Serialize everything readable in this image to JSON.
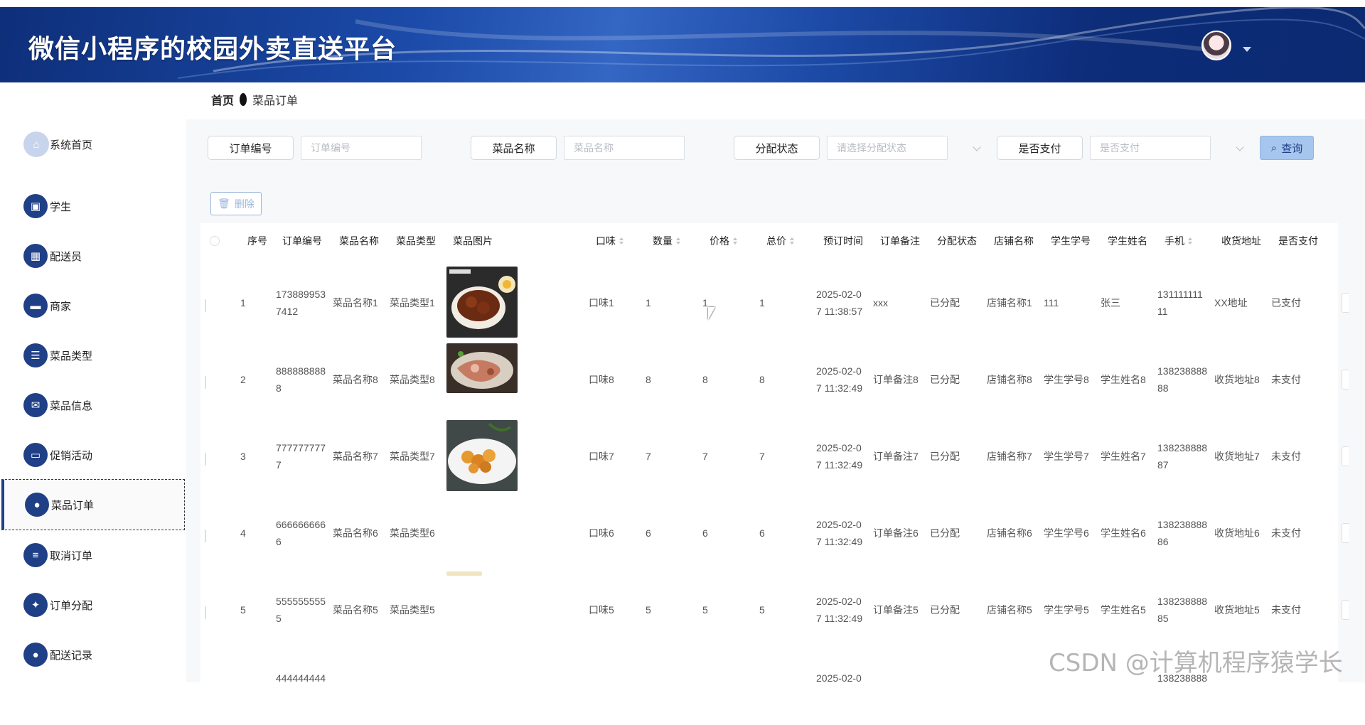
{
  "header": {
    "title": "微信小程序的校园外卖直送平台"
  },
  "breadcrumb": {
    "home": "首页",
    "current": "菜品订单"
  },
  "sidebar": {
    "items": [
      {
        "label": "系统首页",
        "icon": "home-icon"
      },
      {
        "label": "学生",
        "icon": "clipboard-icon"
      },
      {
        "label": "配送员",
        "icon": "grid-icon"
      },
      {
        "label": "商家",
        "icon": "monitor-icon"
      },
      {
        "label": "菜品类型",
        "icon": "list-icon"
      },
      {
        "label": "菜品信息",
        "icon": "message-icon"
      },
      {
        "label": "促销活动",
        "icon": "screen-icon"
      },
      {
        "label": "菜品订单",
        "icon": "bulb-icon"
      },
      {
        "label": "取消订单",
        "icon": "sliders-icon"
      },
      {
        "label": "订单分配",
        "icon": "ticket-icon"
      },
      {
        "label": "配送记录",
        "icon": "user-icon"
      }
    ],
    "active_index": 7
  },
  "search": {
    "order_no_label": "订单编号",
    "order_no_placeholder": "订单编号",
    "dish_name_label": "菜品名称",
    "dish_name_placeholder": "菜品名称",
    "assign_label": "分配状态",
    "assign_placeholder": "请选择分配状态",
    "paid_label": "是否支付",
    "paid_placeholder": "是否支付",
    "query_label": "查询"
  },
  "toolbar": {
    "delete_label": "删除"
  },
  "table": {
    "columns": [
      "序号",
      "订单编号",
      "菜品名称",
      "菜品类型",
      "菜品图片",
      "口味",
      "数量",
      "价格",
      "总价",
      "预订时间",
      "订单备注",
      "分配状态",
      "店铺名称",
      "学生学号",
      "学生姓名",
      "手机",
      "收货地址",
      "是否支付"
    ],
    "rows": [
      {
        "idx": "1",
        "order_l1": "173889953",
        "order_l2": "7412",
        "name": "菜品名称1",
        "type": "菜品类型1",
        "taste": "口味1",
        "qty": "1",
        "price": "1",
        "total": "1",
        "time_l1": "2025-02-0",
        "time_l2": "7 11:38:57",
        "note": "xxx",
        "assign": "已分配",
        "shop": "店铺名称1",
        "sno": "111",
        "sname": "张三",
        "phone_l1": "131111111",
        "phone_l2": "11",
        "addr": "XX地址",
        "paid": "已支付"
      },
      {
        "idx": "2",
        "order_l1": "888888888",
        "order_l2": "8",
        "name": "菜品名称8",
        "type": "菜品类型8",
        "taste": "口味8",
        "qty": "8",
        "price": "8",
        "total": "8",
        "time_l1": "2025-02-0",
        "time_l2": "7 11:32:49",
        "note": "订单备注8",
        "assign": "已分配",
        "shop": "店铺名称8",
        "sno": "学生学号8",
        "sname": "学生姓名8",
        "phone_l1": "138238888",
        "phone_l2": "88",
        "addr": "收货地址8",
        "paid": "未支付"
      },
      {
        "idx": "3",
        "order_l1": "777777777",
        "order_l2": "7",
        "name": "菜品名称7",
        "type": "菜品类型7",
        "taste": "口味7",
        "qty": "7",
        "price": "7",
        "total": "7",
        "time_l1": "2025-02-0",
        "time_l2": "7 11:32:49",
        "note": "订单备注7",
        "assign": "已分配",
        "shop": "店铺名称7",
        "sno": "学生学号7",
        "sname": "学生姓名7",
        "phone_l1": "138238888",
        "phone_l2": "87",
        "addr": "收货地址7",
        "paid": "未支付"
      },
      {
        "idx": "4",
        "order_l1": "666666666",
        "order_l2": "6",
        "name": "菜品名称6",
        "type": "菜品类型6",
        "taste": "口味6",
        "qty": "6",
        "price": "6",
        "total": "6",
        "time_l1": "2025-02-0",
        "time_l2": "7 11:32:49",
        "note": "订单备注6",
        "assign": "已分配",
        "shop": "店铺名称6",
        "sno": "学生学号6",
        "sname": "学生姓名6",
        "phone_l1": "138238888",
        "phone_l2": "86",
        "addr": "收货地址6",
        "paid": "未支付"
      },
      {
        "idx": "5",
        "order_l1": "555555555",
        "order_l2": "5",
        "name": "菜品名称5",
        "type": "菜品类型5",
        "taste": "口味5",
        "qty": "5",
        "price": "5",
        "total": "5",
        "time_l1": "2025-02-0",
        "time_l2": "7 11:32:49",
        "note": "订单备注5",
        "assign": "已分配",
        "shop": "店铺名称5",
        "sno": "学生学号5",
        "sname": "学生姓名5",
        "phone_l1": "138238888",
        "phone_l2": "85",
        "addr": "收货地址5",
        "paid": "未支付"
      },
      {
        "idx": "",
        "order_l1": "444444444",
        "order_l2": "",
        "name": "",
        "type": "",
        "taste": "",
        "qty": "",
        "price": "",
        "total": "",
        "time_l1": "2025-02-0",
        "time_l2": "",
        "note": "",
        "assign": "",
        "shop": "",
        "sno": "",
        "sname": "",
        "phone_l1": "138238888",
        "phone_l2": "",
        "addr": "",
        "paid": ""
      }
    ]
  },
  "watermark": "CSDN @计算机程序猿学长",
  "colors": {
    "header": "#1b4aa8",
    "menu_icon": "#1f3f86",
    "query_button": "#a7c6ee"
  }
}
